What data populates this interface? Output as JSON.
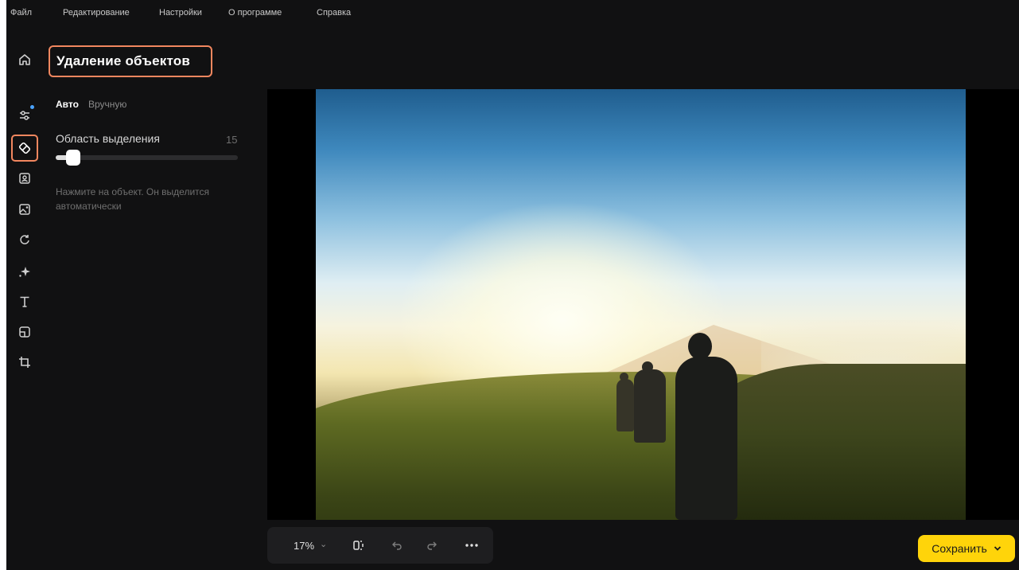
{
  "menu": {
    "file": "Файл",
    "edit": "Редактирование",
    "settings": "Настройки",
    "about": "О программе",
    "help": "Справка"
  },
  "panel": {
    "title": "Удаление объектов",
    "tabs": {
      "auto": "Авто",
      "manual": "Вручную",
      "active": "auto"
    },
    "slider": {
      "label": "Область выделения",
      "value": "15",
      "fill_fraction": 0.12
    },
    "hint": "Нажмите на объект. Он выделится автоматически"
  },
  "rail": {
    "icons": [
      "home-icon",
      "adjustments-icon",
      "eraser-icon",
      "portrait-icon",
      "image-replace-icon",
      "transform-icon",
      "effects-icon",
      "text-icon",
      "frame-icon",
      "crop-icon"
    ],
    "active": "eraser-icon"
  },
  "toolbar": {
    "zoom": "17%",
    "save_label": "Сохранить"
  },
  "colors": {
    "accent_outline": "#f2875f",
    "save_button": "#ffd40a",
    "notification_dot": "#4aa3ff"
  }
}
